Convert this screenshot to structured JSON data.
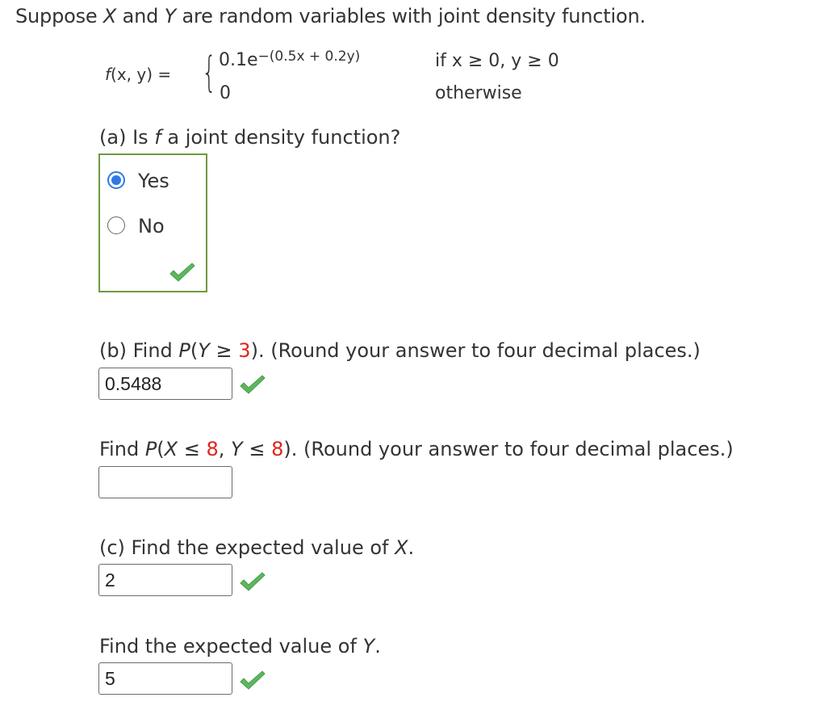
{
  "intro": {
    "prefix": "Suppose ",
    "var_x": "X",
    "mid": " and ",
    "var_y": "Y",
    "suffix": " are random variables with joint density function."
  },
  "formula": {
    "lhs_fn": "f",
    "lhs_args": "(x, y) =",
    "brace": "{",
    "case1_coef": "0.1e",
    "case1_exp": "−(0.5x + 0.2y)",
    "case1_cond": "if x ≥ 0, y ≥ 0",
    "case2_value": "0",
    "case2_cond": "otherwise"
  },
  "part_a": {
    "prefix": "(a) Is ",
    "fn": "f",
    "suffix": " a joint density function?",
    "options": [
      {
        "label": "Yes",
        "selected": true
      },
      {
        "label": "No",
        "selected": false
      }
    ],
    "status": "correct"
  },
  "part_b": {
    "q1": {
      "prefix": "(b) Find ",
      "expr_italic": "P",
      "expr_open": "(",
      "expr_var": "Y",
      "expr_op": " ≥ ",
      "expr_val": "3",
      "expr_close": ").",
      "suffix": " (Round your answer to four decimal places.)",
      "answer": "0.5488",
      "status": "correct"
    },
    "q2": {
      "prefix": "Find ",
      "expr_italic": "P",
      "expr_open": "(",
      "var_x": "X",
      "op1": " ≤ ",
      "val1": "8",
      "sep": ", ",
      "var_y": "Y",
      "op2": " ≤ ",
      "val2": "8",
      "expr_close": ").",
      "suffix": " (Round your answer to four decimal places.)",
      "answer": "",
      "status": "unanswered"
    }
  },
  "part_c": {
    "q1": {
      "prefix": "(c) Find the expected value of ",
      "var": "X",
      "suffix": ".",
      "answer": "2",
      "status": "correct"
    },
    "q2": {
      "prefix": "Find the expected value of ",
      "var": "Y",
      "suffix": ".",
      "answer": "5",
      "status": "correct"
    }
  },
  "colors": {
    "correct_green": "#6f9a3e",
    "checkmark_green": "#5cb85c",
    "highlight_red": "#e1241b",
    "radio_blue": "#2f7ae5",
    "text": "#333333"
  }
}
